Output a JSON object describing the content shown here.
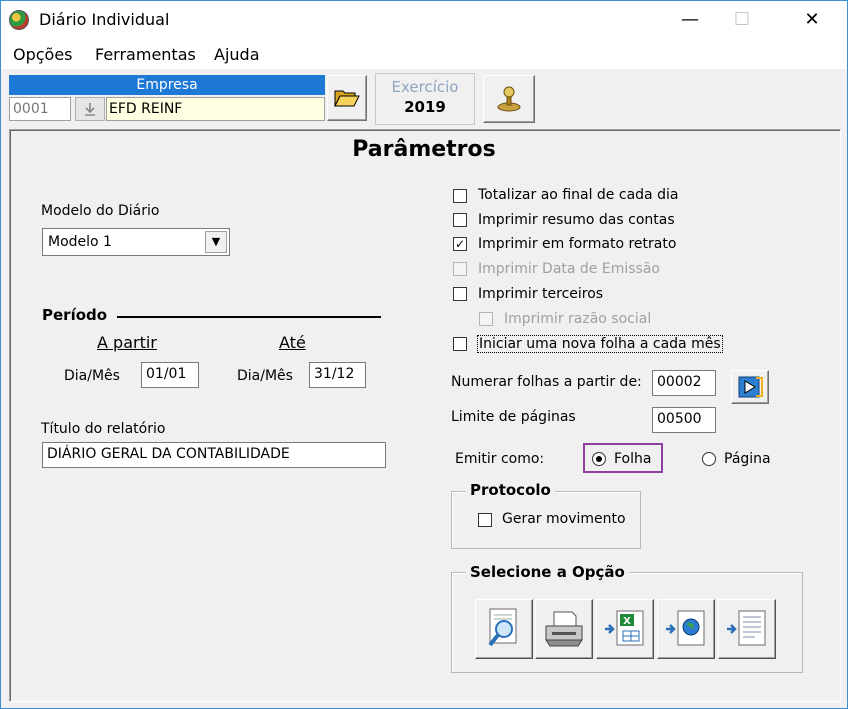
{
  "window": {
    "title": "Diário Individual",
    "minimize": "—",
    "maximize": "☐",
    "close": "✕"
  },
  "menu": {
    "items": [
      "Opções",
      "Ferramentas",
      "Ajuda"
    ]
  },
  "empresa": {
    "header": "Empresa",
    "code": "0001",
    "name": "EFD REINF"
  },
  "exercicio": {
    "label": "Exercício",
    "year": "2019"
  },
  "panel": {
    "title": "Parâmetros"
  },
  "modelo": {
    "label": "Modelo do Diário",
    "selected": "Modelo 1"
  },
  "periodo": {
    "heading": "Período",
    "from_heading": "A partir",
    "to_heading": "Até",
    "from_label": "Dia/Mês",
    "from_value": "01/01",
    "to_label": "Dia/Mês",
    "to_value": "31/12"
  },
  "titulo": {
    "label": "Título do relatório",
    "value": "DIÁRIO GERAL DA CONTABILIDADE"
  },
  "options": [
    {
      "label": "Totalizar ao final de cada dia",
      "checked": false,
      "enabled": true
    },
    {
      "label": "Imprimir resumo das contas",
      "checked": false,
      "enabled": true
    },
    {
      "label": "Imprimir em formato retrato",
      "checked": true,
      "enabled": true
    },
    {
      "label": "Imprimir Data de Emissão",
      "checked": false,
      "enabled": false
    },
    {
      "label": "Imprimir terceiros",
      "checked": false,
      "enabled": true
    },
    {
      "label": "Imprimir razão social",
      "checked": false,
      "enabled": false
    },
    {
      "label": "Iniciar uma nova folha a cada mês",
      "checked": false,
      "enabled": true
    }
  ],
  "numerar": {
    "label": "Numerar folhas a partir de:",
    "value": "00002"
  },
  "limite": {
    "label": "Limite de páginas",
    "value": "00500"
  },
  "emitir": {
    "label": "Emitir como:",
    "option_folha": "Folha",
    "option_pagina": "Página",
    "selected": "Folha"
  },
  "protocolo": {
    "title": "Protocolo",
    "checkbox_label": "Gerar movimento"
  },
  "selecione": {
    "title": "Selecione a Opção"
  },
  "colors": {
    "accent": "#1e78d6",
    "highlight": "#8e3fa0",
    "input_yellow": "#ffffe1"
  }
}
